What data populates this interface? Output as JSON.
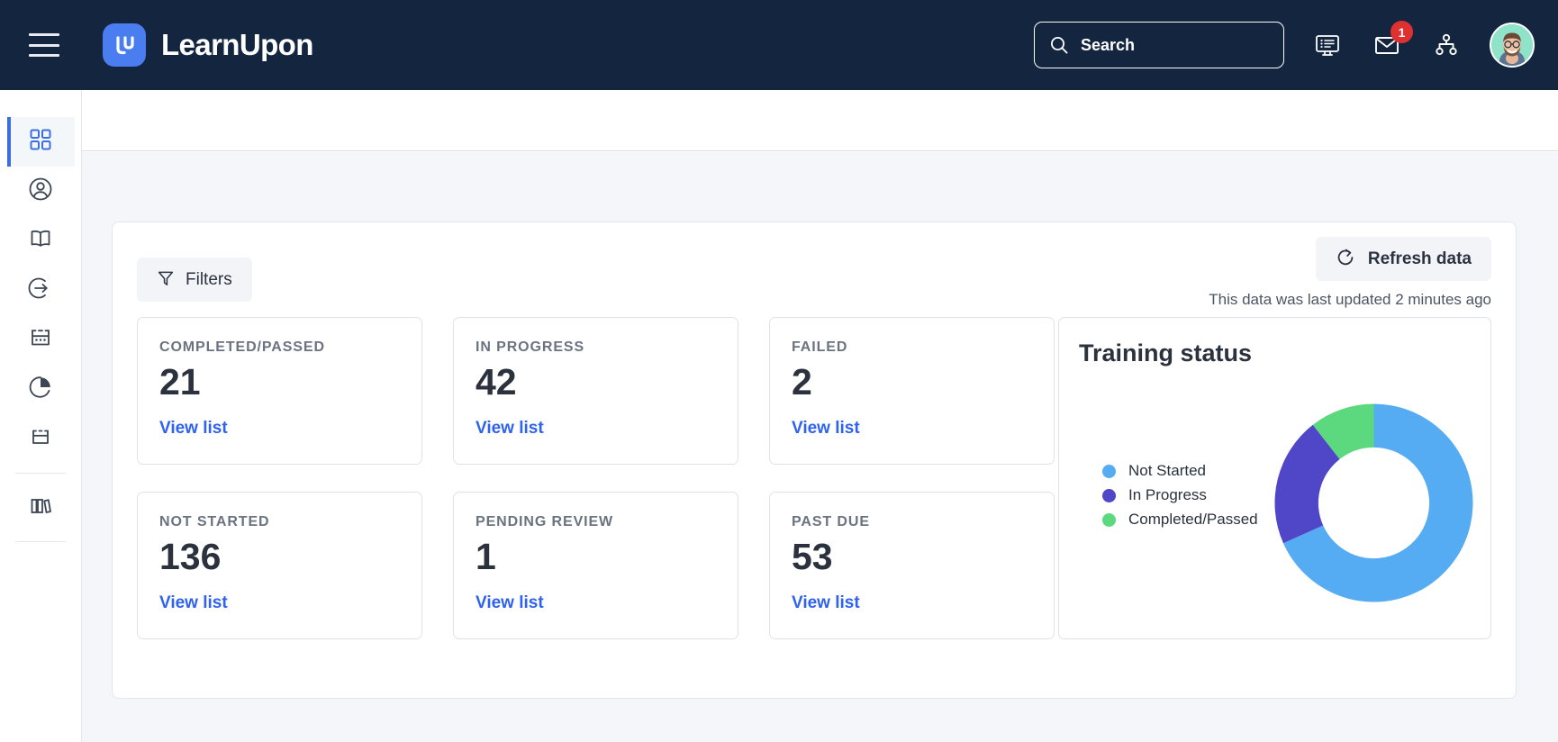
{
  "header": {
    "menu_icon": "hamburger-icon",
    "brand_name": "LearnUpon",
    "brand_logo": "learnupon-logo",
    "search": {
      "placeholder": "Search",
      "value": "",
      "icon": "search-icon"
    },
    "icons": [
      {
        "name": "dashboard-monitor-icon",
        "badge": null
      },
      {
        "name": "mail-envelope-icon",
        "badge": "1"
      },
      {
        "name": "org-chart-icon",
        "badge": null
      }
    ],
    "avatar": {
      "name": "user-avatar",
      "alt": "User profile photo"
    },
    "colors": {
      "background": "#14253f",
      "brand_blue": "#4a7ef0",
      "badge_red": "#e03131"
    }
  },
  "sidebar": {
    "items": [
      {
        "icon": "grid-dashboard-icon",
        "active": true
      },
      {
        "icon": "user-circle-icon",
        "active": false
      },
      {
        "icon": "open-book-icon",
        "active": false
      },
      {
        "icon": "enter-arrow-icon",
        "active": false
      },
      {
        "icon": "calendar-dots-icon",
        "active": false
      },
      {
        "icon": "pie-chart-icon",
        "active": false
      },
      {
        "icon": "calendar-icon",
        "active": false
      },
      {
        "icon": "divider",
        "active": false
      },
      {
        "icon": "library-books-icon",
        "active": false
      },
      {
        "icon": "divider",
        "active": false
      }
    ],
    "active_color": "#3b6fe0"
  },
  "toolbar": {
    "filters_label": "Filters",
    "filters_icon": "funnel-icon",
    "refresh_label": "Refresh data",
    "refresh_icon": "refresh-icon",
    "updated_text": "This data was last updated 2 minutes ago"
  },
  "cards": {
    "link_label": "View list",
    "row1": [
      {
        "label": "COMPLETED/PASSED",
        "value": "21",
        "link": "View list"
      },
      {
        "label": "IN PROGRESS",
        "value": "42",
        "link": "View list"
      },
      {
        "label": "FAILED",
        "value": "2",
        "link": "View list"
      }
    ],
    "row2": [
      {
        "label": "NOT STARTED",
        "value": "136",
        "link": "View list"
      },
      {
        "label": "PENDING REVIEW",
        "value": "1",
        "link": "View list"
      },
      {
        "label": "PAST DUE",
        "value": "53",
        "link": "View list"
      }
    ]
  },
  "chart_data": {
    "type": "pie",
    "variant": "donut",
    "title": "Training status",
    "categories": [
      "Not Started",
      "In Progress",
      "Completed/Passed"
    ],
    "values": [
      136,
      42,
      21
    ],
    "percentages": [
      68.3,
      21.1,
      10.6
    ],
    "colors": [
      "#56acf2",
      "#4f46c8",
      "#5cd97f"
    ],
    "legend_position": "left",
    "grid": false,
    "xlabel": "",
    "ylabel": "",
    "start_angle": 0,
    "inner_radius_ratio": 0.56
  }
}
